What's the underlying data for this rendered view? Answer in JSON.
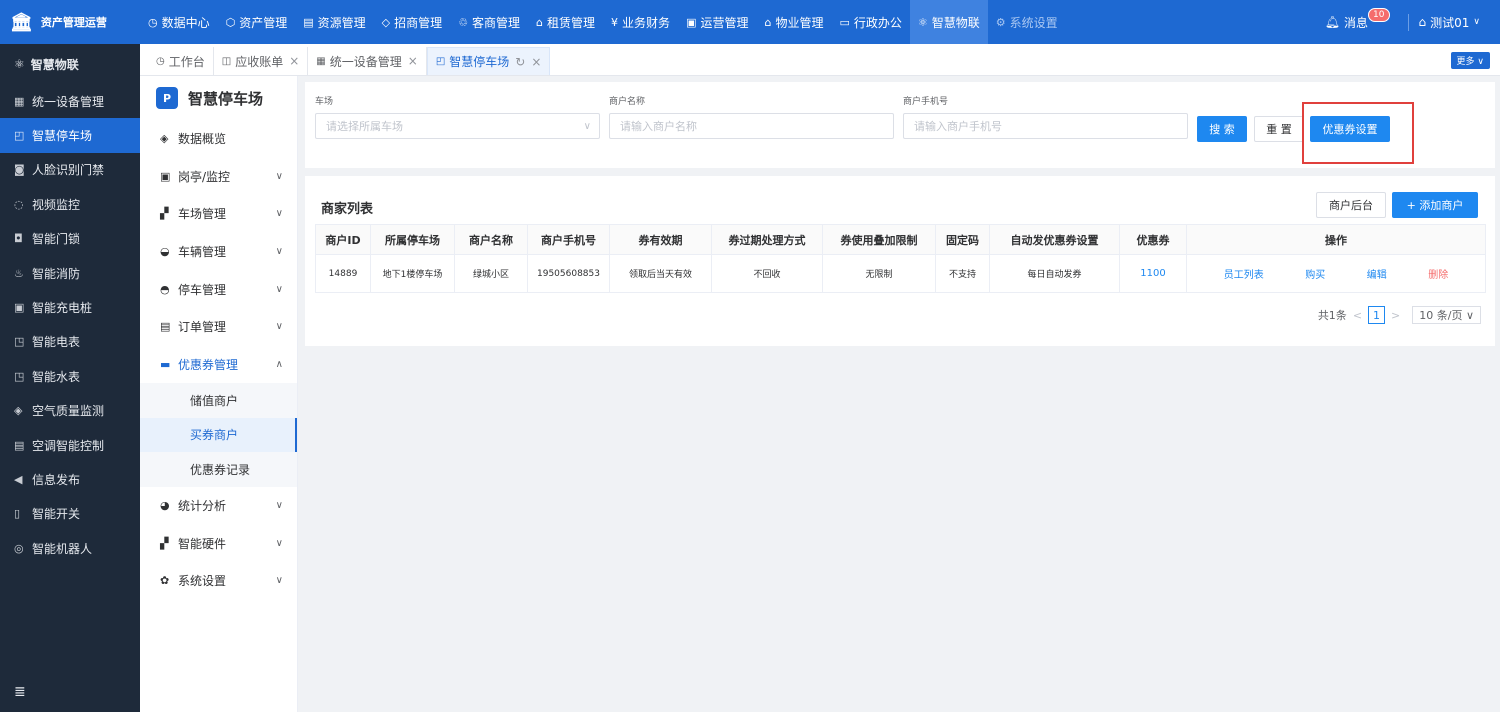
{
  "app": {
    "logo_icon": "🏛",
    "title": "资产管理运营"
  },
  "topnav": [
    {
      "icon": "clock-icon",
      "glyph": "◷",
      "label": "数据中心"
    },
    {
      "icon": "cube-icon",
      "glyph": "⬡",
      "label": "资产管理"
    },
    {
      "icon": "building-icon",
      "glyph": "▤",
      "label": "资源管理"
    },
    {
      "icon": "tag-icon",
      "glyph": "◇",
      "label": "招商管理"
    },
    {
      "icon": "people-icon",
      "glyph": "♲",
      "label": "客商管理"
    },
    {
      "icon": "home-icon",
      "glyph": "⌂",
      "label": "租赁管理"
    },
    {
      "icon": "money-icon",
      "glyph": "¥",
      "label": "业务财务"
    },
    {
      "icon": "chart-icon",
      "glyph": "▣",
      "label": "运营管理"
    },
    {
      "icon": "house-icon",
      "glyph": "⌂",
      "label": "物业管理"
    },
    {
      "icon": "monitor-icon",
      "glyph": "▭",
      "label": "行政办公"
    },
    {
      "icon": "iot-icon",
      "glyph": "⚛",
      "label": "智慧物联"
    },
    {
      "icon": "gear-icon",
      "glyph": "⚙",
      "label": "系统设置"
    }
  ],
  "topright": {
    "messages_label": "消息",
    "messages_count": "10",
    "user_label": "测试01"
  },
  "sidebar": {
    "header": "智慧物联",
    "items": [
      {
        "glyph": "▦",
        "label": "统一设备管理"
      },
      {
        "glyph": "◰",
        "label": "智慧停车场"
      },
      {
        "glyph": "◙",
        "label": "人脸识别门禁"
      },
      {
        "glyph": "◌",
        "label": "视频监控"
      },
      {
        "glyph": "◘",
        "label": "智能门锁"
      },
      {
        "glyph": "♨",
        "label": "智能消防"
      },
      {
        "glyph": "▣",
        "label": "智能充电桩"
      },
      {
        "glyph": "◳",
        "label": "智能电表"
      },
      {
        "glyph": "◳",
        "label": "智能水表"
      },
      {
        "glyph": "◈",
        "label": "空气质量监测"
      },
      {
        "glyph": "▤",
        "label": "空调智能控制"
      },
      {
        "glyph": "◀",
        "label": "信息发布"
      },
      {
        "glyph": "▯",
        "label": "智能开关"
      },
      {
        "glyph": "◎",
        "label": "智能机器人"
      }
    ],
    "collapse_glyph": "≣"
  },
  "tabs": [
    {
      "glyph": "◷",
      "label": "工作台"
    },
    {
      "glyph": "◫",
      "label": "应收账单",
      "close": "×"
    },
    {
      "glyph": "▦",
      "label": "统一设备管理",
      "close": "×"
    },
    {
      "glyph": "◰",
      "label": "智慧停车场",
      "refresh": "↻",
      "close": "×"
    }
  ],
  "more_label": "更多 ∨",
  "submenu": {
    "title": "智慧停车场",
    "items": [
      {
        "glyph": "◈",
        "label": "数据概览",
        "chev": ""
      },
      {
        "glyph": "▣",
        "label": "岗亭/监控",
        "chev": "∨"
      },
      {
        "glyph": "▞",
        "label": "车场管理",
        "chev": "∨"
      },
      {
        "glyph": "◒",
        "label": "车辆管理",
        "chev": "∨"
      },
      {
        "glyph": "◓",
        "label": "停车管理",
        "chev": "∨"
      },
      {
        "glyph": "▤",
        "label": "订单管理",
        "chev": "∨"
      }
    ],
    "open_item": {
      "glyph": "▬",
      "label": "优惠券管理",
      "chev": "∧"
    },
    "sub_items": [
      "储值商户",
      "买券商户",
      "优惠券记录"
    ],
    "after_items": [
      {
        "glyph": "◕",
        "label": "统计分析",
        "chev": "∨"
      },
      {
        "glyph": "▞",
        "label": "智能硬件",
        "chev": "∨"
      },
      {
        "glyph": "✿",
        "label": "系统设置",
        "chev": "∨"
      }
    ]
  },
  "search": {
    "parking": {
      "label": "车场",
      "placeholder": "请选择所属车场",
      "caret": "∨"
    },
    "name": {
      "label": "商户名称",
      "placeholder": "请输入商户名称"
    },
    "phone": {
      "label": "商户手机号",
      "placeholder": "请输入商户手机号"
    },
    "search_btn": "搜 索",
    "reset_btn": "重 置",
    "coupon_btn": "优惠券设置"
  },
  "list": {
    "title": "商家列表",
    "backend_btn": "商户后台",
    "add_btn": "+  添加商户",
    "columns": [
      "商户ID",
      "所属停车场",
      "商户名称",
      "商户手机号",
      "券有效期",
      "券过期处理方式",
      "券使用叠加限制",
      "固定码",
      "自动发优惠券设置",
      "优惠券",
      "操作"
    ],
    "rows": [
      {
        "id": "14889",
        "parking": "地下1楼停车场",
        "name": "绿城小区",
        "phone": "19505608853",
        "validity": "领取后当天有效",
        "expire": "不回收",
        "limit": "无限制",
        "code": "不支持",
        "auto": "每日自动发券",
        "coupon": "1100",
        "ops": {
          "staff": "员工列表",
          "buy": "购买",
          "edit": "编辑",
          "delete": "删除"
        }
      }
    ]
  },
  "pager": {
    "total": "共1条",
    "prev": "<",
    "page": "1",
    "next": ">",
    "size": "10 条/页 ∨"
  }
}
